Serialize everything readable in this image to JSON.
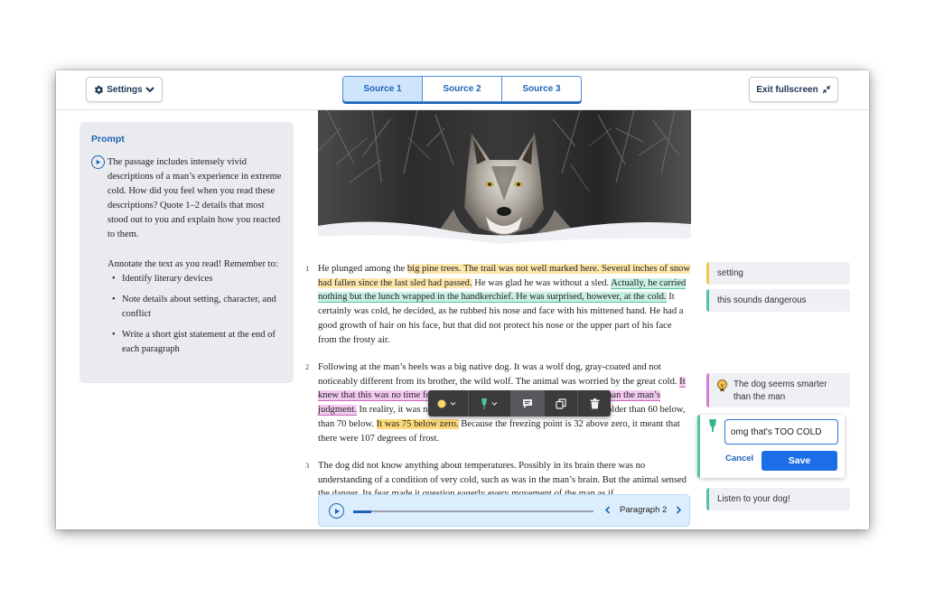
{
  "header": {
    "settings_label": "Settings",
    "tabs": [
      {
        "label": "Source 1",
        "active": true
      },
      {
        "label": "Source 2",
        "active": false
      },
      {
        "label": "Source 3",
        "active": false
      }
    ],
    "exit_label": "Exit fullscreen"
  },
  "prompt": {
    "title": "Prompt",
    "text": "The passage includes intensely vivid descriptions of a man’s experience in extreme cold. How did you feel when you read these descriptions? Quote 1–2 details that most stood out to you and explain how you reacted to them.",
    "instructions": "Annotate the text as you read! Remember to:",
    "bullets": [
      "Identify literary devices",
      "Note details about setting, character, and conflict",
      "Write a short gist statement at the end of each paragraph"
    ]
  },
  "passage": {
    "p1": {
      "num": "1",
      "a": "He plunged among the ",
      "hl1": "big pine trees. The trail was not well marked here. Several inches of snow had fallen since the last sled had passed.",
      "b": " He was glad he was without a sled. ",
      "hl2": "Actually, he carried nothing but the lunch wrapped in the handkerchief. He was surprised, however, at the cold.",
      "c": " It certainly was cold, he decided, as he rubbed his nose and face with his mittened hand. He had a good growth of hair on his face, but that did not protect his nose or the upper part of his face from the frosty air."
    },
    "p2": {
      "num": "2",
      "a": "Following at the man’s heels was a big native dog. It was a wolf dog, gray-coated and not noticeably different from its brother, the wild wolf. The animal was worried by the great cold. ",
      "hl1": "It knew that this was no time for traveling. Its instinct was closer to the truth than the man’s judgment.",
      "b": " In reality, it was not merely colder than fifty below zero; it was colder than 60 below, than 70 below. ",
      "hl2": "It was 75 below zero.",
      "c": " Because the freezing point is 32 above zero, it meant that there were 107 degrees of frost."
    },
    "p3": {
      "num": "3",
      "text": "The dog did not know anything about temperatures. Possibly in its brain there was no understanding of a condition of very cold, such as was in the man’s brain. But the animal sensed the danger. Its fear made it question eagerly every movement of the man as if"
    }
  },
  "player": {
    "paragraph_label": "Paragraph 2",
    "progress": 0.075
  },
  "notes": {
    "n1": "setting",
    "n2": "this sounds dangerous",
    "n3": "The dog seems smarter than the man",
    "editor_value": "omg that's TOO COLD",
    "cancel_label": "Cancel",
    "save_label": "Save",
    "n4": "Listen to your dog!"
  },
  "colors": {
    "accent": "#1f63b8",
    "highlight_yellow": "#fde7ad",
    "highlight_green": "#c9efe4",
    "highlight_pink": "#f3cbef",
    "save_button": "#1c6ee8"
  }
}
